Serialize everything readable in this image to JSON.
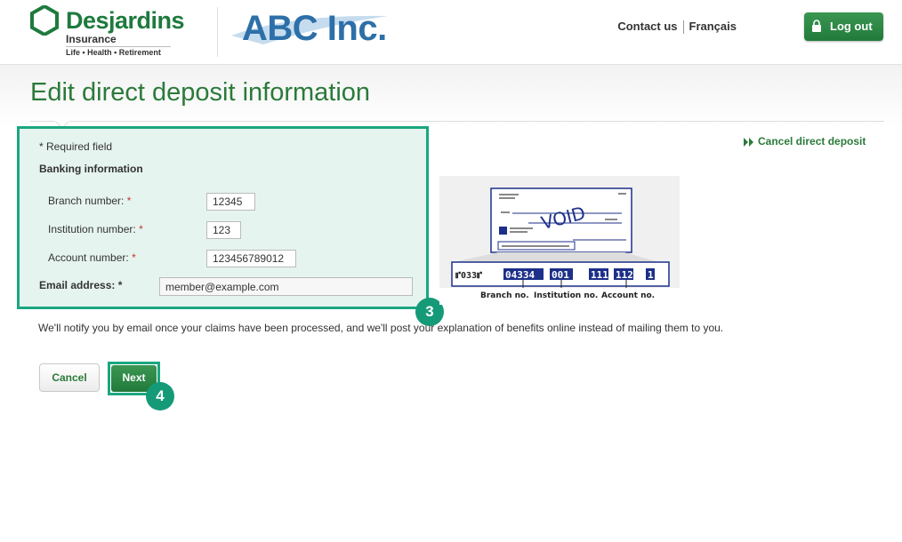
{
  "header": {
    "brand": {
      "name": "Desjardins",
      "sub": "Insurance",
      "tagline": "Life • Health • Retirement"
    },
    "partner": "ABC Inc.",
    "links": {
      "contact": "Contact us",
      "language": "Français"
    },
    "logout_label": "Log out",
    "icons": {
      "logout": "lock-icon",
      "brand": "desjardins-hexagon-logo"
    }
  },
  "page": {
    "title": "Edit direct deposit information"
  },
  "form": {
    "required_note": "* Required field",
    "banking_heading": "Banking information",
    "branch": {
      "label": "Branch number:",
      "required": "*",
      "value": "12345"
    },
    "institution": {
      "label": "Institution number:",
      "required": "*",
      "value": "123"
    },
    "account": {
      "label": "Account number:",
      "required": "*",
      "value": "123456789012"
    },
    "email": {
      "label": "Email address:",
      "required": "*",
      "value": "member@example.com"
    }
  },
  "cancel_direct_deposit": {
    "label": "Cancel direct deposit",
    "icon": "double-chevron-right-icon"
  },
  "cheque": {
    "void_text": "VOID",
    "micr": {
      "prefix": "⑈033⑈",
      "branch": "04334",
      "institution": "001",
      "account_a": "111",
      "account_b": "112",
      "account_c": "1"
    },
    "captions": {
      "branch": "Branch no.",
      "institution": "Institution no.",
      "account": "Account no."
    }
  },
  "notice": "We'll notify you by email once your claims have been processed, and we'll post your explanation of benefits online instead of mailing them to you.",
  "buttons": {
    "cancel": "Cancel",
    "next": "Next"
  },
  "callouts": {
    "form": "3",
    "next": "4"
  },
  "colors": {
    "brand_green": "#2b7a3a",
    "callout_teal": "#1aa780",
    "abc_blue": "#2d6fa8"
  }
}
